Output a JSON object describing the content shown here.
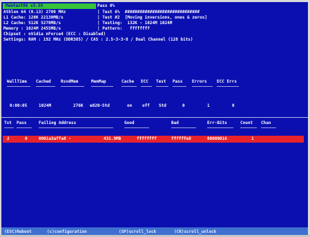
{
  "title_bar": "Memtest86 v3.55",
  "pass_info": "Pass 0%",
  "info_lines": [
    "Athlon 64 (0.13) 2700 MHz",
    "L1 Cache: 128K 22130MB/s",
    "L2 Cache: 512K 5270MB/s",
    "Memory : 1024M 2455MB/s",
    "Chipset : nVidia nForce4 (ECC : Disabled)",
    "Settings: RAM : 192 MHz (DDR385) / CAS : 2.5-3-3-8 / Dual Channel (128 bits)"
  ],
  "right_lines": [
    "| Test 6%  ##############################",
    "| Test #2  [Moving inversions, ones & zeros]",
    "| Testing:  132K - 1024M 1024M",
    "| Pattern:   ffffffff",
    "",
    ""
  ],
  "table": {
    "headers": [
      "WallTime",
      "Cached",
      "RsvdMem",
      "MemMap",
      "Cache",
      "ECC",
      "Test",
      "Pass",
      "Errors",
      "ECC Errs"
    ],
    "row": [
      "0:00:05",
      "1024M",
      "276K",
      "e820-Std",
      "on",
      "off",
      "Std",
      "0",
      "1",
      "0"
    ]
  },
  "errors_table": {
    "headers": [
      "Tst",
      "Pass",
      "Failing Address",
      "Good",
      "Bad",
      "Err-Bits",
      "Count",
      "Chan"
    ],
    "row": [
      "2",
      "0",
      "0001a3affa8 -",
      "431.9MB",
      "ffffffff",
      "ffffffe8",
      "00000016",
      "1"
    ]
  },
  "statusbar": [
    "(ESC)Reboot",
    "(c)configuration",
    "(SP)scroll_lock",
    "(CR)scroll_unlock"
  ],
  "colors": {
    "background": "#0b0fb0",
    "title_bar": "#37c43a",
    "error_row": "#e8232b",
    "statusbar": "#3f6fd0"
  }
}
